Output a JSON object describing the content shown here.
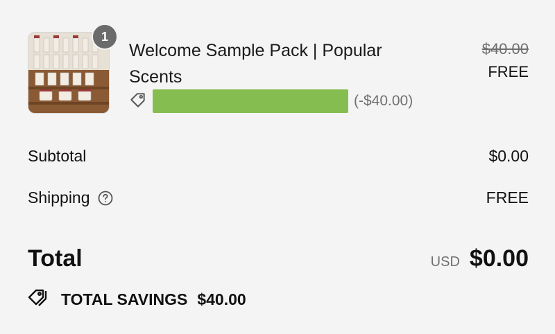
{
  "line_item": {
    "quantity": "1",
    "title": "Welcome Sample Pack | Popular Scents",
    "original_price": "$40.00",
    "price": "FREE",
    "discount_amount": "(-$40.00)"
  },
  "summary": {
    "subtotal_label": "Subtotal",
    "subtotal_value": "$0.00",
    "shipping_label": "Shipping",
    "shipping_value": "FREE",
    "total_label": "Total",
    "currency": "USD",
    "total_value": "$0.00",
    "savings_label": "TOTAL SAVINGS",
    "savings_value": "$40.00"
  },
  "icons": {
    "discount_tag": "tag-icon",
    "shipping_help": "help-circle-icon",
    "savings_tags": "tags-icon"
  },
  "colors": {
    "redacted_code": "#86bd50",
    "badge": "#6b6b6b"
  }
}
